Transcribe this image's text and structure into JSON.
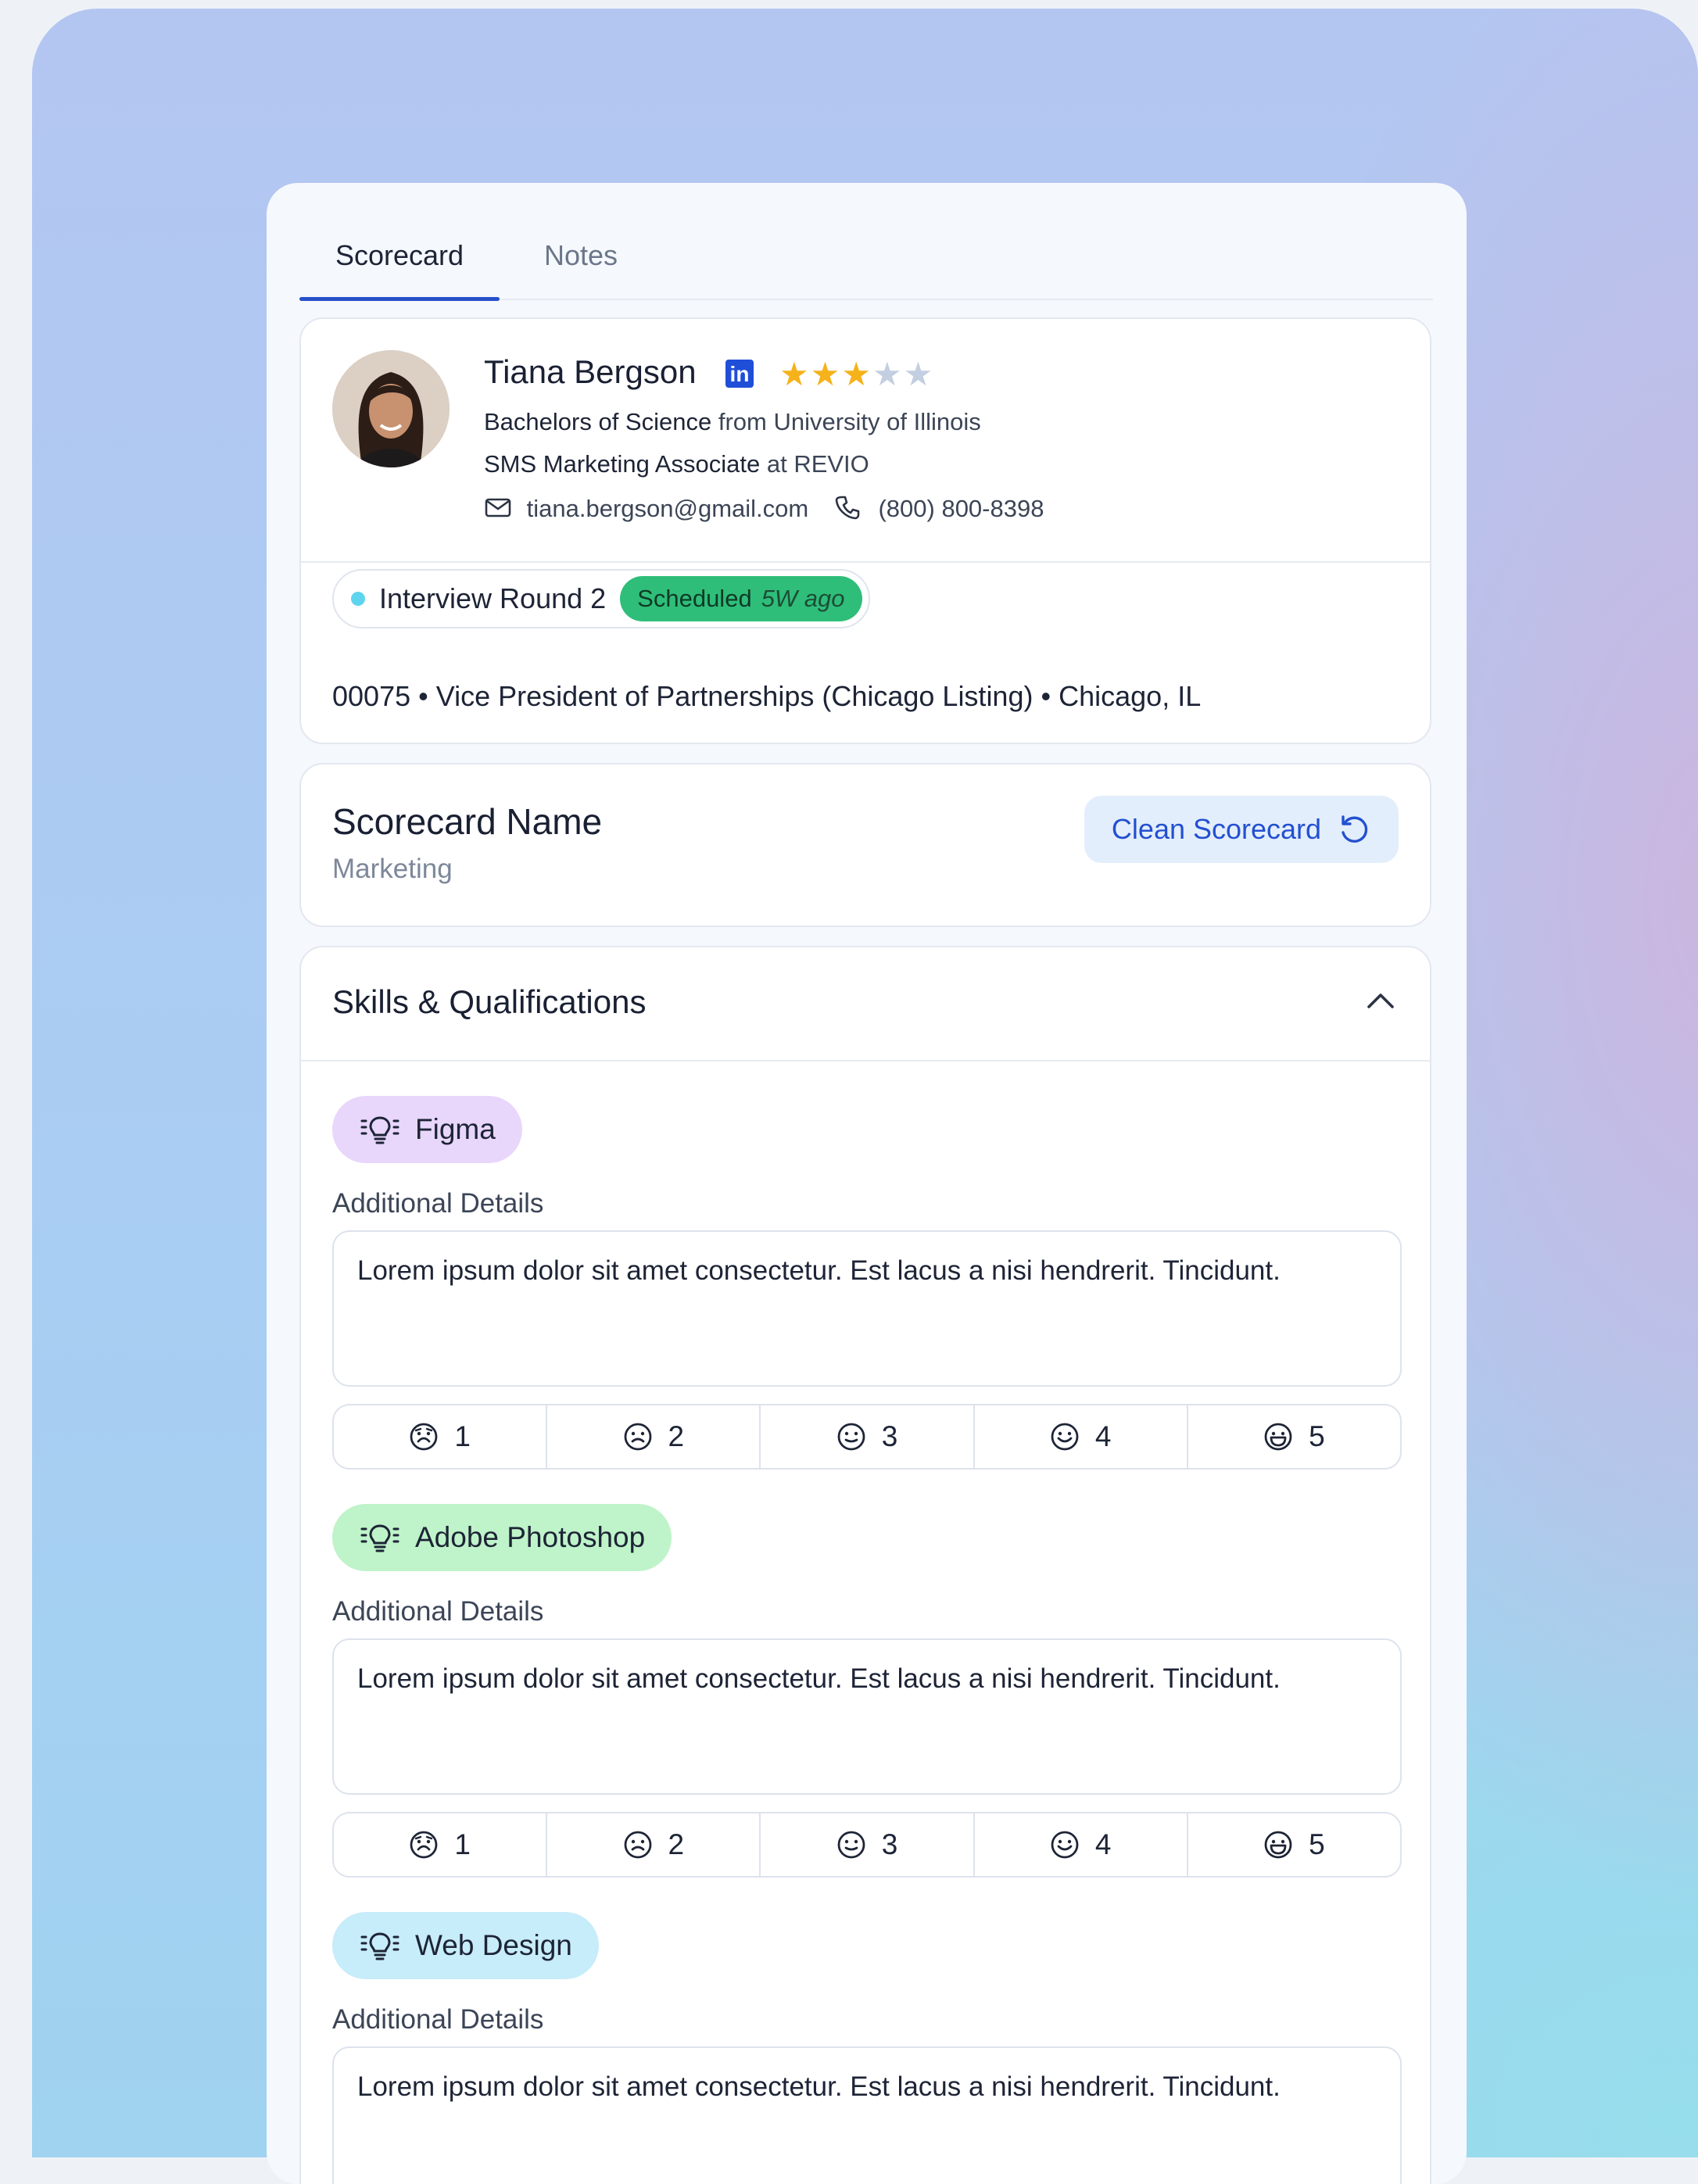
{
  "tabs": [
    {
      "label": "Scorecard",
      "active": true
    },
    {
      "label": "Notes",
      "active": false
    }
  ],
  "candidate": {
    "name": "Tiana Bergson",
    "rating": 3,
    "rating_max": 5,
    "degree": "Bachelors of Science",
    "degree_connector": "from",
    "school": "University of Illinois",
    "role": "SMS Marketing Associate",
    "role_connector": "at",
    "company": "REVIO",
    "email": "tiana.bergson@gmail.com",
    "phone": "(800) 800-8398"
  },
  "interview": {
    "round": "Interview Round 2",
    "status": "Scheduled",
    "when": "5W ago"
  },
  "listing": {
    "id": "00075",
    "title": "Vice President of Partnerships (Chicago Listing)",
    "location": "Chicago, IL",
    "separator": "•"
  },
  "scorecard": {
    "title": "Scorecard Name",
    "name": "Marketing",
    "clean_label": "Clean Scorecard"
  },
  "skills_section": {
    "title": "Skills & Qualifications",
    "skills": [
      {
        "name": "Figma",
        "color": "#e8d6fb",
        "details_label": "Additional Details",
        "details": "Lorem ipsum dolor sit amet consectetur. Est lacus a nisi hendrerit. Tincidunt."
      },
      {
        "name": "Adobe Photoshop",
        "color": "#bff3c9",
        "details_label": "Additional Details",
        "details": "Lorem ipsum dolor sit amet consectetur. Est lacus a nisi hendrerit. Tincidunt."
      },
      {
        "name": "Web Design",
        "color": "#c7ecfa",
        "details_label": "Additional Details",
        "details": "Lorem ipsum dolor sit amet consectetur. Est lacus a nisi hendrerit. Tincidunt."
      }
    ],
    "rating_options": [
      "1",
      "2",
      "3",
      "4",
      "5"
    ]
  },
  "colors": {
    "accent": "#2650c9",
    "star_filled": "#f6b21b",
    "star_empty": "#c3cfe0",
    "scheduled_badge": "#2fbe7a"
  }
}
